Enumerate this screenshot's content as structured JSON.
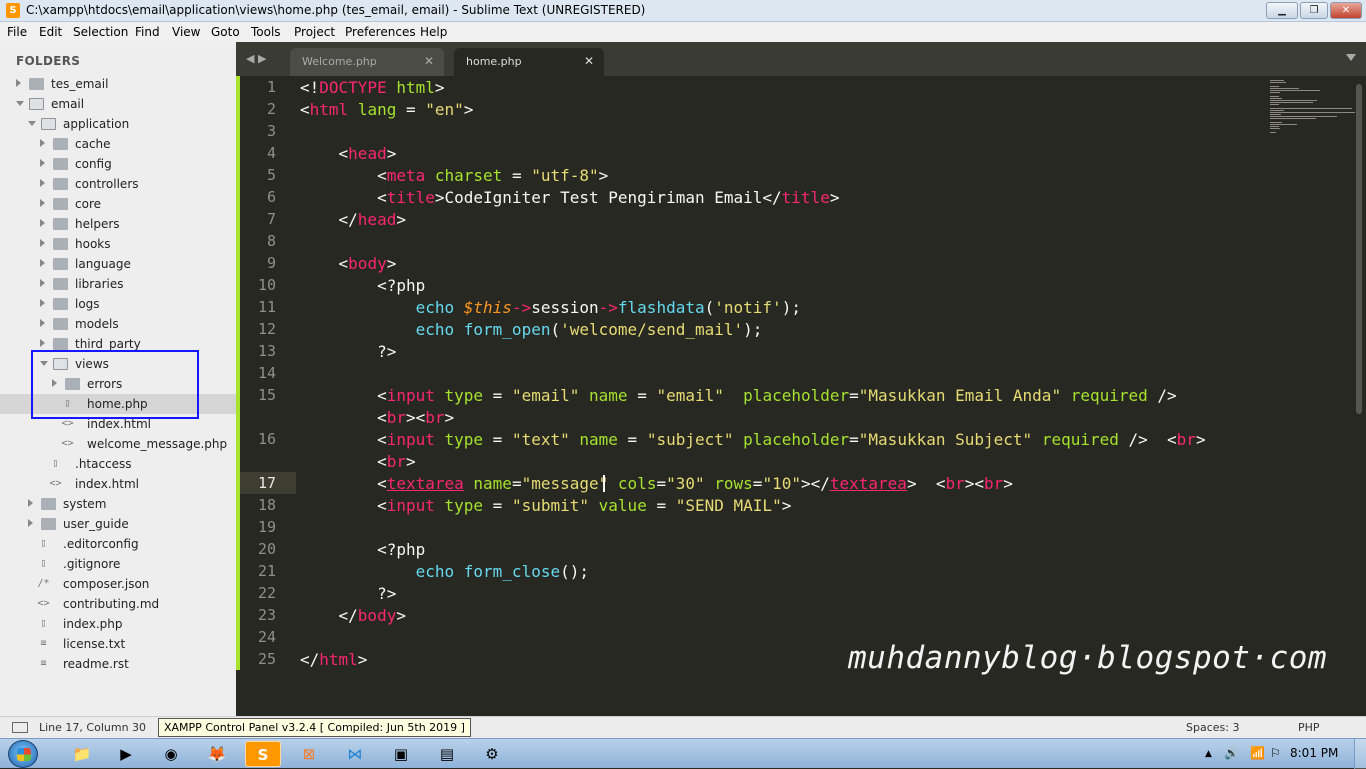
{
  "window": {
    "title": "C:\\xampp\\htdocs\\email\\application\\views\\home.php (tes_email, email) - Sublime Text (UNREGISTERED)",
    "minimize_glyph": "▁",
    "maximize_glyph": "❐",
    "close_glyph": "✕"
  },
  "menu": [
    "File",
    "Edit",
    "Selection",
    "Find",
    "View",
    "Goto",
    "Tools",
    "Project",
    "Preferences",
    "Help"
  ],
  "sidebar": {
    "header": "FOLDERS",
    "items": [
      {
        "label": "tes_email",
        "depth": 0,
        "kind": "folder",
        "state": "collapsed"
      },
      {
        "label": "email",
        "depth": 0,
        "kind": "folder",
        "state": "expanded"
      },
      {
        "label": "application",
        "depth": 1,
        "kind": "folder",
        "state": "expanded"
      },
      {
        "label": "cache",
        "depth": 2,
        "kind": "folder",
        "state": "collapsed"
      },
      {
        "label": "config",
        "depth": 2,
        "kind": "folder",
        "state": "collapsed"
      },
      {
        "label": "controllers",
        "depth": 2,
        "kind": "folder",
        "state": "collapsed"
      },
      {
        "label": "core",
        "depth": 2,
        "kind": "folder",
        "state": "collapsed"
      },
      {
        "label": "helpers",
        "depth": 2,
        "kind": "folder",
        "state": "collapsed"
      },
      {
        "label": "hooks",
        "depth": 2,
        "kind": "folder",
        "state": "collapsed"
      },
      {
        "label": "language",
        "depth": 2,
        "kind": "folder",
        "state": "collapsed"
      },
      {
        "label": "libraries",
        "depth": 2,
        "kind": "folder",
        "state": "collapsed"
      },
      {
        "label": "logs",
        "depth": 2,
        "kind": "folder",
        "state": "collapsed"
      },
      {
        "label": "models",
        "depth": 2,
        "kind": "folder",
        "state": "collapsed"
      },
      {
        "label": "third_party",
        "depth": 2,
        "kind": "folder",
        "state": "collapsed"
      },
      {
        "label": "views",
        "depth": 2,
        "kind": "folder",
        "state": "expanded"
      },
      {
        "label": "errors",
        "depth": 3,
        "kind": "folder",
        "state": "collapsed"
      },
      {
        "label": "home.php",
        "depth": 3,
        "kind": "file",
        "icon": "document-icon",
        "selected": true
      },
      {
        "label": "index.html",
        "depth": 3,
        "kind": "file",
        "icon": "code-icon"
      },
      {
        "label": "welcome_message.php",
        "depth": 3,
        "kind": "file",
        "icon": "code-icon"
      },
      {
        "label": ".htaccess",
        "depth": 2,
        "kind": "file",
        "icon": "document-icon"
      },
      {
        "label": "index.html",
        "depth": 2,
        "kind": "file",
        "icon": "code-icon"
      },
      {
        "label": "system",
        "depth": 1,
        "kind": "folder",
        "state": "collapsed"
      },
      {
        "label": "user_guide",
        "depth": 1,
        "kind": "folder",
        "state": "collapsed"
      },
      {
        "label": ".editorconfig",
        "depth": 1,
        "kind": "file",
        "icon": "document-icon"
      },
      {
        "label": ".gitignore",
        "depth": 1,
        "kind": "file",
        "icon": "document-icon"
      },
      {
        "label": "composer.json",
        "depth": 1,
        "kind": "file",
        "icon": "json-icon"
      },
      {
        "label": "contributing.md",
        "depth": 1,
        "kind": "file",
        "icon": "code-icon"
      },
      {
        "label": "index.php",
        "depth": 1,
        "kind": "file",
        "icon": "document-icon"
      },
      {
        "label": "license.txt",
        "depth": 1,
        "kind": "file",
        "icon": "text-icon"
      },
      {
        "label": "readme.rst",
        "depth": 1,
        "kind": "file",
        "icon": "text-icon"
      }
    ]
  },
  "tabs": [
    {
      "label": "Welcome.php",
      "active": false,
      "close": "✕"
    },
    {
      "label": "home.php",
      "active": true,
      "close": "✕"
    }
  ],
  "tab_nav": "◀ ▶",
  "editor": {
    "current_line": 17,
    "line_numbers": [
      "1",
      "2",
      "3",
      "4",
      "5",
      "6",
      "7",
      "8",
      "9",
      "10",
      "11",
      "12",
      "13",
      "14",
      "15",
      "",
      "16",
      "",
      "17",
      "18",
      "19",
      "20",
      "21",
      "22",
      "23",
      "24",
      "25"
    ],
    "lines": [
      [
        [
          "p",
          "<!"
        ],
        [
          "t",
          "DOCTYPE"
        ],
        [
          "p",
          " "
        ],
        [
          "a",
          "html"
        ],
        [
          "p",
          ">"
        ]
      ],
      [
        [
          "p",
          "<"
        ],
        [
          "t",
          "html"
        ],
        [
          "p",
          " "
        ],
        [
          "a",
          "lang"
        ],
        [
          "p",
          " = "
        ],
        [
          "s",
          "\"en\""
        ],
        [
          "p",
          ">"
        ]
      ],
      [],
      [
        [
          "p",
          "    <"
        ],
        [
          "t",
          "head"
        ],
        [
          "p",
          ">"
        ]
      ],
      [
        [
          "p",
          "        <"
        ],
        [
          "t",
          "meta"
        ],
        [
          "p",
          " "
        ],
        [
          "a",
          "charset"
        ],
        [
          "p",
          " = "
        ],
        [
          "s",
          "\"utf-8\""
        ],
        [
          "p",
          ">"
        ]
      ],
      [
        [
          "p",
          "        <"
        ],
        [
          "t",
          "title"
        ],
        [
          "p",
          ">CodeIgniter Test Pengiriman Email</"
        ],
        [
          "t",
          "title"
        ],
        [
          "p",
          ">"
        ]
      ],
      [
        [
          "p",
          "    </"
        ],
        [
          "t",
          "head"
        ],
        [
          "p",
          ">"
        ]
      ],
      [],
      [
        [
          "p",
          "    <"
        ],
        [
          "t",
          "body"
        ],
        [
          "p",
          ">"
        ]
      ],
      [
        [
          "p",
          "        <?php"
        ]
      ],
      [
        [
          "p",
          "            "
        ],
        [
          "f",
          "echo"
        ],
        [
          "p",
          " "
        ],
        [
          "v",
          "$this"
        ],
        [
          "t",
          "->"
        ],
        [
          "p",
          "session"
        ],
        [
          "t",
          "->"
        ],
        [
          "f",
          "flashdata"
        ],
        [
          "p",
          "("
        ],
        [
          "s",
          "'notif'"
        ],
        [
          "p",
          ");"
        ]
      ],
      [
        [
          "p",
          "            "
        ],
        [
          "f",
          "echo"
        ],
        [
          "p",
          " "
        ],
        [
          "f",
          "form_open"
        ],
        [
          "p",
          "("
        ],
        [
          "s",
          "'welcome/send_mail'"
        ],
        [
          "p",
          ");"
        ]
      ],
      [
        [
          "p",
          "        ?>"
        ]
      ],
      [],
      [
        [
          "p",
          "        <"
        ],
        [
          "t",
          "input"
        ],
        [
          "p",
          " "
        ],
        [
          "a",
          "type"
        ],
        [
          "p",
          " = "
        ],
        [
          "s",
          "\"email\""
        ],
        [
          "p",
          " "
        ],
        [
          "a",
          "name"
        ],
        [
          "p",
          " = "
        ],
        [
          "s",
          "\"email\""
        ],
        [
          "p",
          "  "
        ],
        [
          "a",
          "placeholder"
        ],
        [
          "p",
          "="
        ],
        [
          "s",
          "\"Masukkan Email Anda\""
        ],
        [
          "p",
          " "
        ],
        [
          "a",
          "required"
        ],
        [
          "p",
          " />"
        ]
      ],
      [
        [
          "p",
          "        <"
        ],
        [
          "t",
          "br"
        ],
        [
          "p",
          "><"
        ],
        [
          "t",
          "br"
        ],
        [
          "p",
          ">"
        ]
      ],
      [
        [
          "p",
          "        <"
        ],
        [
          "t",
          "input"
        ],
        [
          "p",
          " "
        ],
        [
          "a",
          "type"
        ],
        [
          "p",
          " = "
        ],
        [
          "s",
          "\"text\""
        ],
        [
          "p",
          " "
        ],
        [
          "a",
          "name"
        ],
        [
          "p",
          " = "
        ],
        [
          "s",
          "\"subject\""
        ],
        [
          "p",
          " "
        ],
        [
          "a",
          "placeholder"
        ],
        [
          "p",
          "="
        ],
        [
          "s",
          "\"Masukkan Subject\""
        ],
        [
          "p",
          " "
        ],
        [
          "a",
          "required"
        ],
        [
          "p",
          " />  <"
        ],
        [
          "t",
          "br"
        ],
        [
          "p",
          ">"
        ]
      ],
      [
        [
          "p",
          "        <"
        ],
        [
          "t",
          "br"
        ],
        [
          "p",
          ">"
        ]
      ],
      [
        [
          "p",
          "        <"
        ],
        [
          "tu",
          "textarea"
        ],
        [
          "p",
          " "
        ],
        [
          "a",
          "name"
        ],
        [
          "p",
          "="
        ],
        [
          "s",
          "\"message\""
        ],
        [
          "p",
          " "
        ],
        [
          "a",
          "cols"
        ],
        [
          "p",
          "="
        ],
        [
          "s",
          "\"30\""
        ],
        [
          "p",
          " "
        ],
        [
          "a",
          "rows"
        ],
        [
          "p",
          "="
        ],
        [
          "s",
          "\"10\""
        ],
        [
          "p",
          "></"
        ],
        [
          "tu",
          "textarea"
        ],
        [
          "p",
          ">  <"
        ],
        [
          "t",
          "br"
        ],
        [
          "p",
          "><"
        ],
        [
          "t",
          "br"
        ],
        [
          "p",
          ">"
        ]
      ],
      [
        [
          "p",
          "        <"
        ],
        [
          "t",
          "input"
        ],
        [
          "p",
          " "
        ],
        [
          "a",
          "type"
        ],
        [
          "p",
          " = "
        ],
        [
          "s",
          "\"submit\""
        ],
        [
          "p",
          " "
        ],
        [
          "a",
          "value"
        ],
        [
          "p",
          " = "
        ],
        [
          "s",
          "\"SEND MAIL\""
        ],
        [
          "p",
          ">"
        ]
      ],
      [],
      [
        [
          "p",
          "        <?php"
        ]
      ],
      [
        [
          "p",
          "            "
        ],
        [
          "f",
          "echo"
        ],
        [
          "p",
          " "
        ],
        [
          "f",
          "form_close"
        ],
        [
          "p",
          "();"
        ]
      ],
      [
        [
          "p",
          "        ?>"
        ]
      ],
      [
        [
          "p",
          "    </"
        ],
        [
          "t",
          "body"
        ],
        [
          "p",
          ">"
        ]
      ],
      [],
      [
        [
          "p",
          "</"
        ],
        [
          "t",
          "html"
        ],
        [
          "p",
          ">"
        ]
      ]
    ]
  },
  "watermark": "muhdannyblog·blogspot·com",
  "status": {
    "position": "Line 17, Column 30",
    "tooltip": "XAMPP Control Panel v3.2.4   [ Compiled: Jun 5th 2019 ]",
    "spaces": "Spaces: 3",
    "syntax": "PHP"
  },
  "taskbar": {
    "apps": [
      {
        "name": "explorer",
        "glyph": "📁"
      },
      {
        "name": "media-player",
        "glyph": "▶"
      },
      {
        "name": "chrome",
        "glyph": "◉"
      },
      {
        "name": "firefox",
        "glyph": "🦊"
      },
      {
        "name": "sublime-text",
        "glyph": "S"
      },
      {
        "name": "xampp",
        "glyph": "⊠"
      },
      {
        "name": "vscode",
        "glyph": "⋈"
      },
      {
        "name": "terminal",
        "glyph": "▣"
      },
      {
        "name": "notepad",
        "glyph": "▤"
      },
      {
        "name": "network-app",
        "glyph": "⚙"
      }
    ],
    "tray": {
      "up_arrow": "▲",
      "volume": "🔊",
      "signal": "📶",
      "flag": "⚐",
      "clock": "8:01 PM"
    }
  },
  "colors": {
    "editor_bg": "#272822",
    "tag": "#f92672",
    "attr": "#a6e22e",
    "string": "#e6db74",
    "func": "#66d9ef",
    "var": "#fd971f",
    "highlight_box": "#1515ff"
  }
}
